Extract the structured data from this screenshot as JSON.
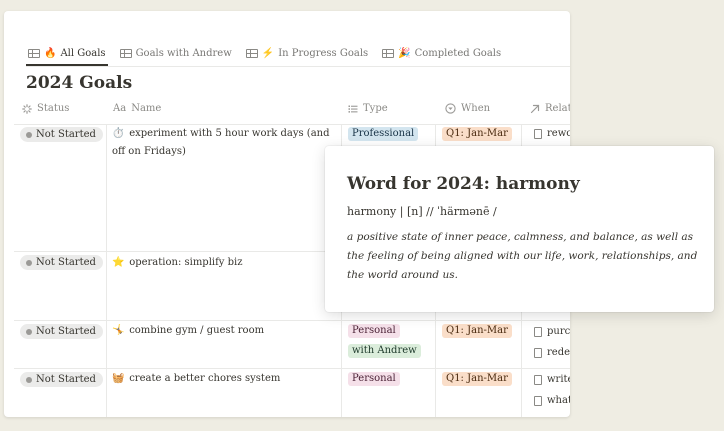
{
  "tabs": [
    {
      "emoji": "🔥",
      "label": "All Goals",
      "active": true
    },
    {
      "emoji": "",
      "label": "Goals with Andrew",
      "active": false
    },
    {
      "emoji": "⚡",
      "label": "In Progress Goals",
      "active": false
    },
    {
      "emoji": "🎉",
      "label": "Completed Goals",
      "active": false
    }
  ],
  "title": "2024 Goals",
  "columns": {
    "status": "Status",
    "name_prefix": "Aa",
    "name": "Name",
    "type": "Type",
    "when": "When",
    "related": "Relate"
  },
  "rows": [
    {
      "status": "Not Started",
      "emoji": "⏱️",
      "name": "experiment with 5 hour work days (and off on Fridays)",
      "types": [
        "Professional"
      ],
      "when": "Q1: Jan-Mar",
      "related": [
        "rewor"
      ]
    },
    {
      "status": "Not Started",
      "emoji": "⭐",
      "name": "operation: simplify biz",
      "types": [],
      "when": "",
      "related": []
    },
    {
      "status": "Not Started",
      "emoji": "🤸",
      "name": "combine gym / guest room",
      "types": [
        "Personal",
        "with Andrew"
      ],
      "when": "Q1: Jan-Mar",
      "related": [
        "purch",
        "redes"
      ]
    },
    {
      "status": "Not Started",
      "emoji": "🧺",
      "name": "create a better chores system",
      "types": [
        "Personal"
      ],
      "when": "Q1: Jan-Mar",
      "related": [
        "write",
        "what"
      ]
    }
  ],
  "popup": {
    "title": "Word for 2024: harmony",
    "phonetic": "harmony | [n] // ˈhärmənē /",
    "definition": "a positive state of inner peace, calmness, and balance, as well as the feeling of being aligned with our life, work, relationships, and the world around us."
  },
  "colors": {
    "background": "#efede3",
    "professional": "#d3e5ef",
    "personal": "#f5e0e9",
    "with_andrew": "#dbeddb",
    "when": "#fadec9",
    "status": "#ebebea"
  }
}
